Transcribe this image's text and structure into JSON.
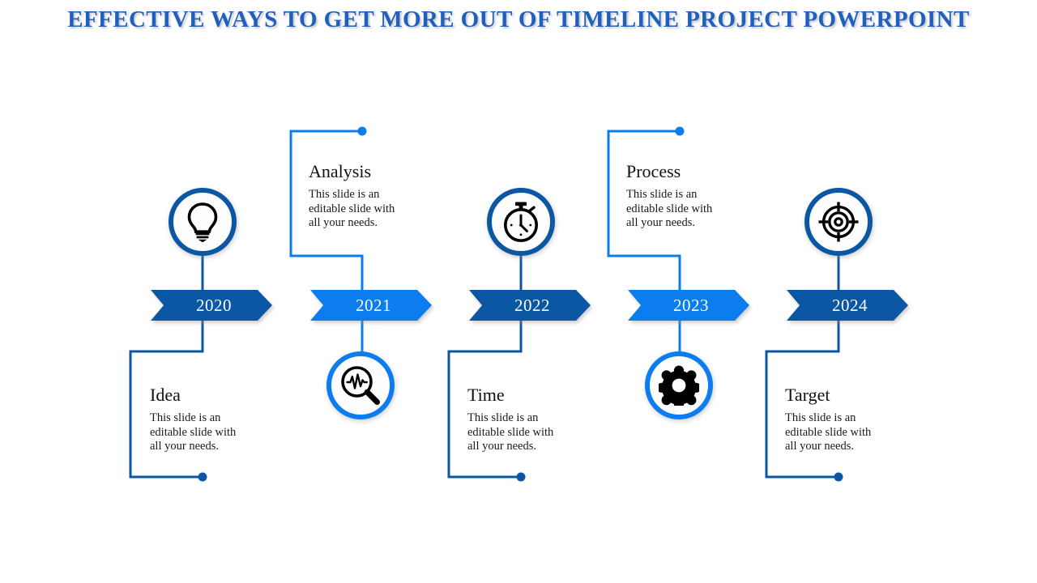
{
  "slide": {
    "title": "EFFECTIVE WAYS TO GET MORE OUT OF TIMELINE PROJECT POWERPOINT",
    "background": "#FFFFFF",
    "title_color": "#1F5FBF"
  },
  "palette": {
    "dark_blue": "#0B57A4",
    "bright_blue": "#0B7DEE",
    "heading_text": "#111111",
    "body_text": "#1A1A1A",
    "chevron_label": "#FFFFFF"
  },
  "body_text_lines": [
    "This slide is an",
    "editable slide with",
    "all your needs."
  ],
  "milestones": [
    {
      "year": "2020",
      "heading": "Idea",
      "body": [
        "This slide is an",
        "editable slide with",
        "all your needs."
      ],
      "icon": "lightbulb-icon",
      "accent": "#0B57A4",
      "tone": "dark",
      "icon_position": "above",
      "text_position": "below"
    },
    {
      "year": "2021",
      "heading": "Analysis",
      "body": [
        "This slide is an",
        "editable slide with",
        "all your needs."
      ],
      "icon": "magnifier-pulse-icon",
      "accent": "#0B7DEE",
      "tone": "light",
      "icon_position": "below",
      "text_position": "above"
    },
    {
      "year": "2022",
      "heading": "Time",
      "body": [
        "This slide is an",
        "editable slide with",
        "all your needs."
      ],
      "icon": "stopwatch-icon",
      "accent": "#0B57A4",
      "tone": "dark",
      "icon_position": "above",
      "text_position": "below"
    },
    {
      "year": "2023",
      "heading": "Process",
      "body": [
        "This slide is an",
        "editable slide with",
        "all your needs."
      ],
      "icon": "gear-icon",
      "accent": "#0B7DEE",
      "tone": "light",
      "icon_position": "below",
      "text_position": "above"
    },
    {
      "year": "2024",
      "heading": "Target",
      "body": [
        "This slide is an",
        "editable slide with",
        "all your needs."
      ],
      "icon": "target-crosshair-icon",
      "accent": "#0B57A4",
      "tone": "dark",
      "icon_position": "above",
      "text_position": "below"
    }
  ]
}
